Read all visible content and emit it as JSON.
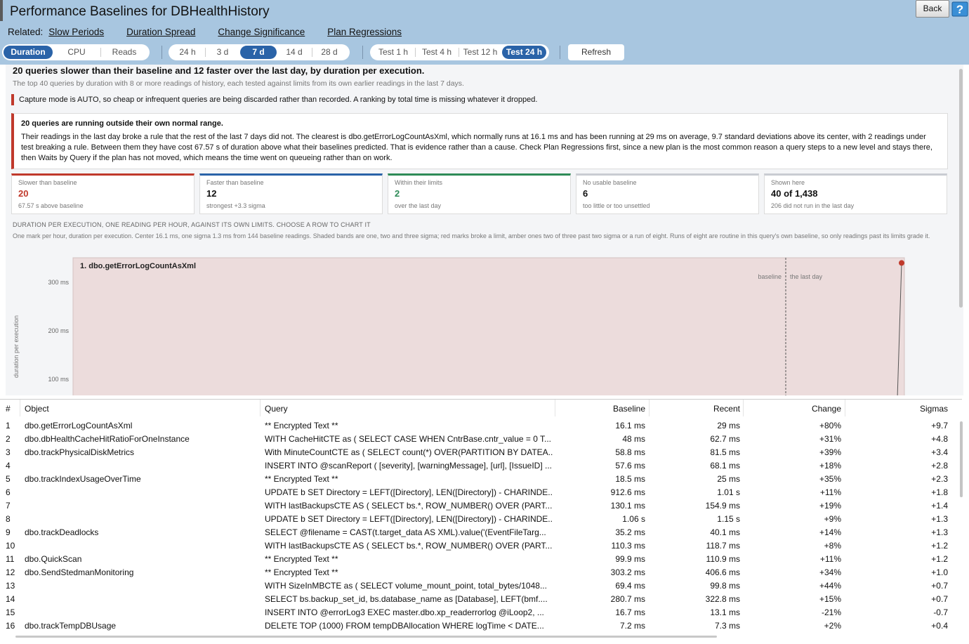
{
  "window": {
    "title": "Performance Baselines for DBHealthHistory",
    "back_label": "Back"
  },
  "related": {
    "label": "Related:",
    "links": [
      "Slow Periods",
      "Duration Spread",
      "Change Significance",
      "Plan Regressions"
    ]
  },
  "metric_tabs": [
    {
      "label": "Duration",
      "selected": true
    },
    {
      "label": "CPU",
      "selected": false
    },
    {
      "label": "Reads",
      "selected": false
    }
  ],
  "window_tabs": [
    {
      "label": "24 h",
      "selected": false
    },
    {
      "label": "3 d",
      "selected": false
    },
    {
      "label": "7 d",
      "selected": true
    },
    {
      "label": "14 d",
      "selected": false
    },
    {
      "label": "28 d",
      "selected": false
    }
  ],
  "test_tabs": [
    {
      "label": "Test 1 h",
      "selected": false
    },
    {
      "label": "Test 4 h",
      "selected": false
    },
    {
      "label": "Test 12 h",
      "selected": false
    },
    {
      "label": "Test 24 h",
      "selected": true
    }
  ],
  "refresh_label": "Refresh",
  "report": {
    "headline": "20 queries slower than their baseline and 12 faster over the last day, by duration per execution.",
    "subline": "The top 40 queries by duration with 8 or more readings of history, each tested against limits from its own earlier readings in the last 7 days.",
    "capture_note": "Capture mode is AUTO, so cheap or infrequent queries are being discarded rather than recorded. A ranking by total time is missing whatever it dropped.",
    "alert_title": "20 queries are running outside their own normal range.",
    "alert_body": "Their readings in the last day broke a rule that the rest of the last 7 days did not. The clearest is dbo.getErrorLogCountAsXml, which normally runs at 16.1 ms and has been running at 29 ms on average, 9.7 standard deviations above its center, with 2 readings under test breaking a rule. Between them they have cost 67.57 s of duration above what their baselines predicted. That is evidence rather than a cause. Check Plan Regressions first, since a new plan is the most common reason a query steps to a new level and stays there, then Waits by Query if the plan has not moved, which means the time went on queueing rather than on work.",
    "stats": [
      {
        "label": "Slower than baseline",
        "value": "20",
        "sub": "67.57 s above baseline",
        "color": "#c0392b",
        "value_color": "#c0392b"
      },
      {
        "label": "Faster than baseline",
        "value": "12",
        "sub": "strongest +3.3 sigma",
        "color": "#2a63a8",
        "value_color": "#111111"
      },
      {
        "label": "Within their limits",
        "value": "2",
        "sub": "over the last day",
        "color": "#2e8b57",
        "value_color": "#2e8b57"
      },
      {
        "label": "No usable baseline",
        "value": "6",
        "sub": "too little or too unsettled",
        "color": "#c9ccd2",
        "value_color": "#111111"
      },
      {
        "label": "Shown here",
        "value": "40 of 1,438",
        "sub": "206 did not run in the last day",
        "color": "#c9ccd2",
        "value_color": "#111111"
      }
    ],
    "chart_caption": "DURATION PER EXECUTION, ONE READING PER HOUR, AGAINST ITS OWN LIMITS. CHOOSE A ROW TO CHART IT",
    "chart_notes": "One mark per hour, duration per execution. Center 16.1 ms, one sigma 1.3 ms from 144 baseline readings. Shaded bands are one, two and three sigma; red marks broke a limit, amber ones two of three past two sigma or a run of eight. Runs of eight are routine in this query's own baseline, so only readings past its limits grade it."
  },
  "chart_data": {
    "type": "line",
    "title": "1. dbo.getErrorLogCountAsXml",
    "ylabel": "duration per execution",
    "yticks": [
      "300 ms",
      "200 ms",
      "100 ms"
    ],
    "ytick_values": [
      300,
      200,
      100
    ],
    "region_labels": [
      "baseline",
      "the last day"
    ],
    "points": [
      {
        "x": "last",
        "y": 340,
        "broke_limit": true
      }
    ],
    "colors": {
      "band": "#ecdcdc",
      "mark": "#c0392b"
    }
  },
  "grid": {
    "columns": [
      "#",
      "Object",
      "Query",
      "Baseline",
      "Recent",
      "Change",
      "Sigmas"
    ],
    "rows": [
      [
        "1",
        "dbo.getErrorLogCountAsXml",
        "** Encrypted Text **",
        "16.1 ms",
        "29 ms",
        "+80%",
        "+9.7"
      ],
      [
        "2",
        "dbo.dbHealthCacheHitRatioForOneInstance",
        "WITH CacheHitCTE as ( SELECT CASE WHEN CntrBase.cntr_value = 0 T...",
        "48 ms",
        "62.7 ms",
        "+31%",
        "+4.8"
      ],
      [
        "3",
        "dbo.trackPhysicalDiskMetrics",
        "With MinuteCountCTE as ( SELECT count(*) OVER(PARTITION BY DATEA...",
        "58.8 ms",
        "81.5 ms",
        "+39%",
        "+3.4"
      ],
      [
        "4",
        "",
        "INSERT INTO @scanReport ( [severity], [warningMessage], [url], [IssueID] ...",
        "57.6 ms",
        "68.1 ms",
        "+18%",
        "+2.8"
      ],
      [
        "5",
        "dbo.trackIndexUsageOverTime",
        "** Encrypted Text **",
        "18.5 ms",
        "25 ms",
        "+35%",
        "+2.3"
      ],
      [
        "6",
        "",
        "UPDATE b SET Directory = LEFT([Directory], LEN([Directory]) - CHARINDE...",
        "912.6 ms",
        "1.01 s",
        "+11%",
        "+1.8"
      ],
      [
        "7",
        "",
        "WITH lastBackupsCTE AS ( SELECT bs.*, ROW_NUMBER() OVER (PART...",
        "130.1 ms",
        "154.9 ms",
        "+19%",
        "+1.4"
      ],
      [
        "8",
        "",
        "UPDATE b SET Directory = LEFT([Directory], LEN([Directory]) - CHARINDE...",
        "1.06 s",
        "1.15 s",
        "+9%",
        "+1.3"
      ],
      [
        "9",
        "dbo.trackDeadlocks",
        "SELECT @filename = CAST(t.target_data AS XML).value('(EventFileTarg...",
        "35.2 ms",
        "40.1 ms",
        "+14%",
        "+1.3"
      ],
      [
        "10",
        "",
        "WITH lastBackupsCTE AS ( SELECT bs.*, ROW_NUMBER() OVER (PART...",
        "110.3 ms",
        "118.7 ms",
        "+8%",
        "+1.2"
      ],
      [
        "11",
        "dbo.QuickScan",
        "** Encrypted Text **",
        "99.9 ms",
        "110.9 ms",
        "+11%",
        "+1.2"
      ],
      [
        "12",
        "dbo.SendStedmanMonitoring",
        "** Encrypted Text **",
        "303.2 ms",
        "406.6 ms",
        "+34%",
        "+1.0"
      ],
      [
        "13",
        "",
        "WITH SizeInMBCTE as ( SELECT volume_mount_point, total_bytes/1048...",
        "69.4 ms",
        "99.8 ms",
        "+44%",
        "+0.7"
      ],
      [
        "14",
        "",
        "SELECT bs.backup_set_id, bs.database_name as [Database], LEFT(bmf....",
        "280.7 ms",
        "322.8 ms",
        "+15%",
        "+0.7"
      ],
      [
        "15",
        "",
        "INSERT INTO @errorLog3 EXEC master.dbo.xp_readerrorlog @iLoop2, ...",
        "16.7 ms",
        "13.1 ms",
        "-21%",
        "-0.7"
      ],
      [
        "16",
        "dbo.trackTempDBUsage",
        "DELETE TOP (1000) FROM tempDBAllocation WHERE logTime < DATE...",
        "7.2 ms",
        "7.3 ms",
        "+2%",
        "+0.4"
      ]
    ]
  }
}
